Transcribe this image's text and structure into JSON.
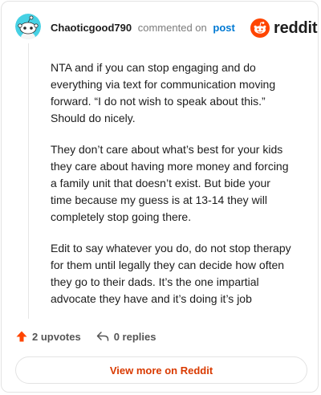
{
  "header": {
    "username": "Chaoticgood790",
    "action_text": "commented on",
    "post_link": "post",
    "brand": "reddit"
  },
  "comment": {
    "paragraphs": [
      "NTA and if you can stop engaging and do everything via text for communication moving forward. “I do not wish to speak about this.” Should do nicely.",
      "They don’t care about what’s best for your kids they care about having more money and forcing a family unit that doesn’t exist. But bide your time because my guess is at 13-14 they will completely stop going there.",
      "Edit to say whatever you do, do not stop therapy for them until legally they can decide how often they go to their dads. It’s the one impartial advocate they have and it’s doing it’s job"
    ]
  },
  "actions": {
    "upvotes_label": "2 upvotes",
    "replies_label": "0 replies"
  },
  "view_more_label": "View more on Reddit",
  "colors": {
    "brand_orange": "#ff4500",
    "link_blue": "#0079d3",
    "view_more_text": "#d93a00",
    "avatar_bg": "#46d1e4"
  },
  "icons": {
    "avatar": "snoo-avatar-icon",
    "logo": "reddit-snoo-icon",
    "upvote": "upvote-arrow-icon",
    "reply": "reply-arrow-icon"
  }
}
